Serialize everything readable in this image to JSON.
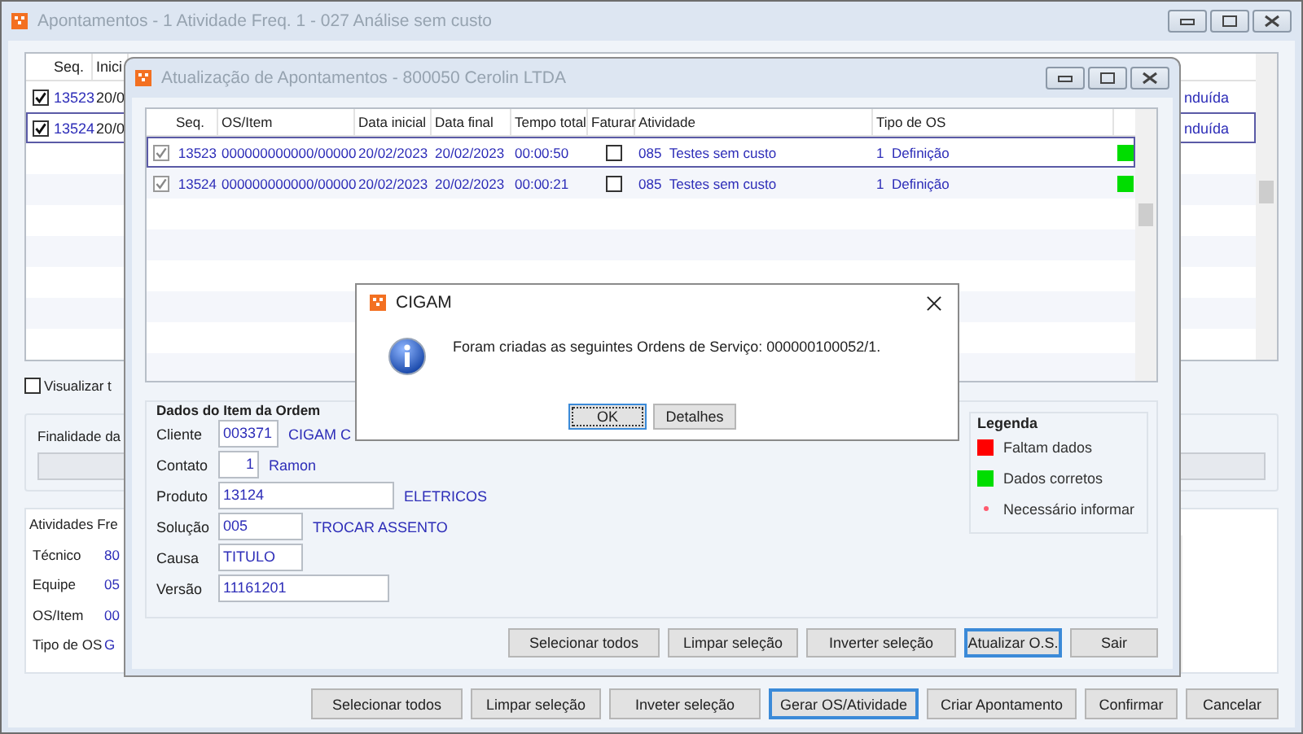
{
  "main_window": {
    "title": "Apontamentos - 1  Atividade Freq. 1 - 027  Análise sem custo",
    "table": {
      "columns": [
        "Seq.",
        "Inici"
      ],
      "rows": [
        {
          "checked": true,
          "selected": false,
          "seq": "13523",
          "column_2": "20/0",
          "column_3": "nduída"
        },
        {
          "checked": true,
          "selected": true,
          "seq": "13524",
          "column_2": "20/0",
          "column_3": "nduída"
        }
      ]
    },
    "show_all": {
      "label": "Visualizar t",
      "checked": false
    },
    "purpose_group": {
      "title": "Finalidade da"
    },
    "activities_panel": {
      "title": "Atividades Fre",
      "fields": [
        {
          "label": "Técnico",
          "value": "80"
        },
        {
          "label": "Equipe",
          "value": "05"
        },
        {
          "label": "OS/Item",
          "value": "00"
        },
        {
          "label": "Tipo de OS",
          "value": "G"
        }
      ]
    },
    "buttons": [
      {
        "label": "Selecionar todos",
        "focused": false
      },
      {
        "label": "Limpar seleção",
        "focused": false
      },
      {
        "label": "Inveter seleção",
        "focused": false
      },
      {
        "label": "Gerar OS/Atividade",
        "focused": true
      },
      {
        "label": "Criar Apontamento",
        "focused": false
      },
      {
        "label": "Confirmar",
        "focused": false
      },
      {
        "label": "Cancelar",
        "focused": false
      }
    ]
  },
  "update_window": {
    "title": "Atualização de Apontamentos  -  800050  Cerolin LTDA",
    "grid": {
      "columns": [
        "Seq.",
        "OS/Item",
        "Data inicial",
        "Data final",
        "Tempo total",
        "Faturar",
        "Atividade",
        "Tipo de OS"
      ],
      "rows": [
        {
          "checked": true,
          "selected": true,
          "seq": "13523",
          "os_item": "000000000000/00000",
          "start": "20/02/2023",
          "end": "20/02/2023",
          "total": "00:00:50",
          "invoice": false,
          "activity_code": "085",
          "activity": "Testes sem custo",
          "os_type_code": "1",
          "os_type": "Definição",
          "color": "#00dd00"
        },
        {
          "checked": true,
          "selected": false,
          "seq": "13524",
          "os_item": "000000000000/00000",
          "start": "20/02/2023",
          "end": "20/02/2023",
          "total": "00:00:21",
          "invoice": false,
          "activity_code": "085",
          "activity": "Testes sem custo",
          "os_type_code": "1",
          "os_type": "Definição",
          "color": "#00dd00"
        }
      ]
    },
    "item_group": {
      "title": "Dados do Item da Ordem",
      "fields": [
        {
          "label": "Cliente",
          "value": "003371",
          "description": "CIGAM C"
        },
        {
          "label": "Contato",
          "value": "1",
          "description": "Ramon"
        },
        {
          "label": "Produto",
          "value": "13124",
          "description": "ELETRICOS"
        },
        {
          "label": "Solução",
          "value": "005",
          "description": "TROCAR ASSENTO"
        },
        {
          "label": "Causa",
          "value": "TITULO"
        },
        {
          "label": "Versão",
          "value": "11161201"
        }
      ]
    },
    "legend": {
      "title": "Legenda",
      "items": [
        {
          "kind": "swatch",
          "color": "#ff0000",
          "label": "Faltam dados"
        },
        {
          "kind": "swatch",
          "color": "#00dd00",
          "label": "Dados corretos"
        },
        {
          "kind": "dot",
          "color": "#ff5a6e",
          "label": "Necessário informar"
        }
      ]
    },
    "buttons": [
      {
        "label": "Selecionar todos",
        "focused": false
      },
      {
        "label": "Limpar seleção",
        "focused": false
      },
      {
        "label": "Inverter seleção",
        "focused": false
      },
      {
        "label": "Atualizar O.S.",
        "focused": true
      },
      {
        "label": "Sair",
        "focused": false
      }
    ]
  },
  "dialog": {
    "title": "CIGAM",
    "message": "Foram criadas as seguintes Ordens de Serviço: 000000100052/1.",
    "buttons": [
      {
        "label": "OK",
        "focused": true
      },
      {
        "label": "Detalhes",
        "focused": false
      }
    ]
  }
}
